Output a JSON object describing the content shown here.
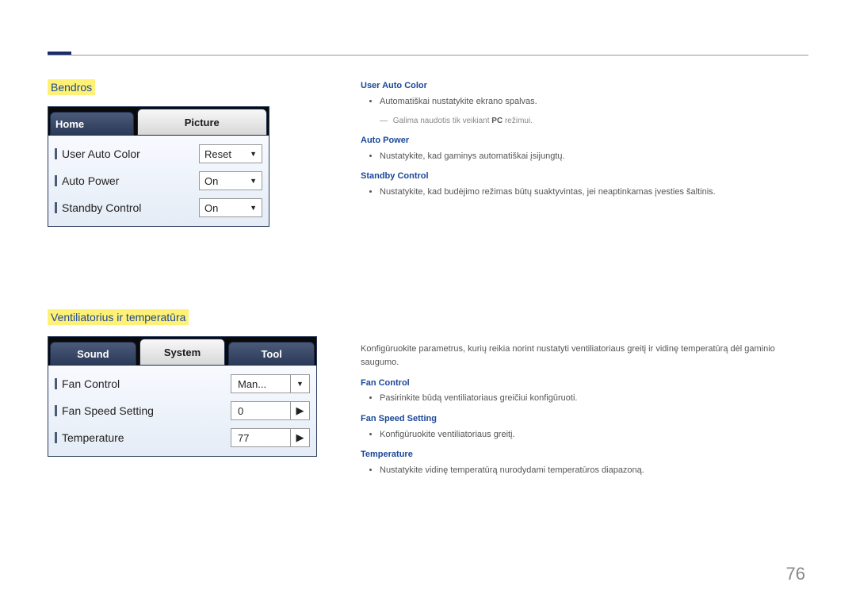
{
  "page_number": "76",
  "section1": {
    "title": "Bendros",
    "ui": {
      "tabs": {
        "home": "Home",
        "picture": "Picture"
      },
      "rows": [
        {
          "label": "User Auto Color",
          "value": "Reset"
        },
        {
          "label": "Auto Power",
          "value": "On"
        },
        {
          "label": "Standby Control",
          "value": "On"
        }
      ]
    },
    "right": {
      "h1": "User Auto Color",
      "p1": "Automatiškai nustatykite ekrano spalvas.",
      "note_prefix": "― ",
      "note_a": "Galima naudotis tik veikiant ",
      "note_pc": "PC",
      "note_b": " režimui.",
      "h2": "Auto Power",
      "p2": "Nustatykite, kad gaminys automatiškai įsijungtų.",
      "h3": "Standby Control",
      "p3": "Nustatykite, kad budėjimo režimas būtų suaktyvintas, jei neaptinkamas įvesties šaltinis."
    }
  },
  "section2": {
    "title": "Ventiliatorius ir temperatūra",
    "ui": {
      "tabs": {
        "sound": "Sound",
        "system": "System",
        "tool": "Tool"
      },
      "rows": [
        {
          "label": "Fan Control",
          "value": "Man...",
          "type": "dropdown"
        },
        {
          "label": "Fan Speed Setting",
          "value": "0",
          "type": "spinner"
        },
        {
          "label": "Temperature",
          "value": "77",
          "type": "spinner"
        }
      ]
    },
    "right": {
      "intro": "Konfigūruokite parametrus, kurių reikia norint nustatyti ventiliatoriaus greitį ir vidinę temperatūrą dėl gaminio saugumo.",
      "h1": "Fan Control",
      "p1": "Pasirinkite būdą ventiliatoriaus greičiui konfigūruoti.",
      "h2": "Fan Speed Setting",
      "p2": "Konfigūruokite ventiliatoriaus greitį.",
      "h3": "Temperature",
      "p3": "Nustatykite vidinę temperatūrą nurodydami temperatūros diapazoną."
    }
  }
}
